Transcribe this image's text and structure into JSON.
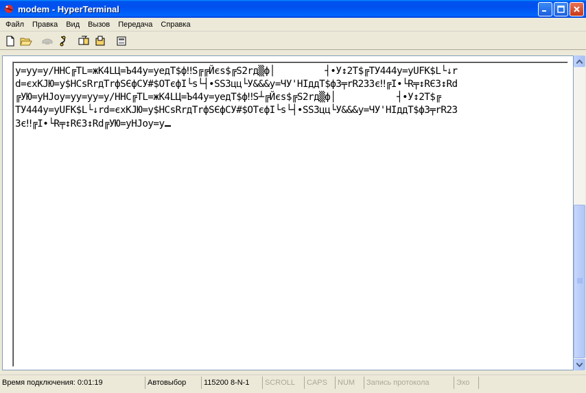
{
  "window": {
    "title": "modem - HyperTerminal"
  },
  "menu": {
    "items": [
      "Файл",
      "Правка",
      "Вид",
      "Вызов",
      "Передача",
      "Справка"
    ]
  },
  "toolbar": {
    "icons": [
      "new-file-icon",
      "open-folder-icon",
      "phone-icon",
      "disconnect-icon",
      "send-icon",
      "receive-icon",
      "properties-icon"
    ]
  },
  "terminal": {
    "lines": [
      "y=yy=y/HHC╔TL=жK4LЦ=Ъ44y=yeдT$ф‼S╔╔Йєs$╔S2rд▒ф│         ┤•У↕2T$╔TУ444y=yUFK$L└↓r",
      "d=єxKJЮ=y$HCsRrдTrфSЄфCУ#$OTєфI└s└┤•SS3цц└У&&&y=ЧУ'HIддT$ф3╤rR233є‼╔I•└R╤↕RЄ3↕Rd",
      "╔УЮ=yHJoy=yy=yy=y/HHC╔TL=жK4LЦ=Ъ44y=yeдT$ф‼S┴╔Йєs$╔S2rд▒ф│           ┤•У↕2T$╔",
      "TУ444y=yUFK$L└↓rd=єxKJЮ=y$HCsRrдTrфSЄфCУ#$OTєфI└s└┤•SS3цц└У&&&y=ЧУ'HIддT$ф3╤rR23",
      "3є‼╔I•└R╤↕RЄ3↕Rd╔УЮ=yHJoy=y"
    ]
  },
  "status": {
    "connect_time": "Время подключения: 0:01:19",
    "detect": "Автовыбор",
    "port": "115200 8-N-1",
    "scroll": "SCROLL",
    "caps": "CAPS",
    "num": "NUM",
    "capture": "Запись протокола",
    "echo": "Эхо"
  },
  "colors": {
    "titlebar": "#0054e3",
    "window_bg": "#ece9d8",
    "terminal_bg": "#ffffff",
    "status_dim": "#aca899"
  }
}
